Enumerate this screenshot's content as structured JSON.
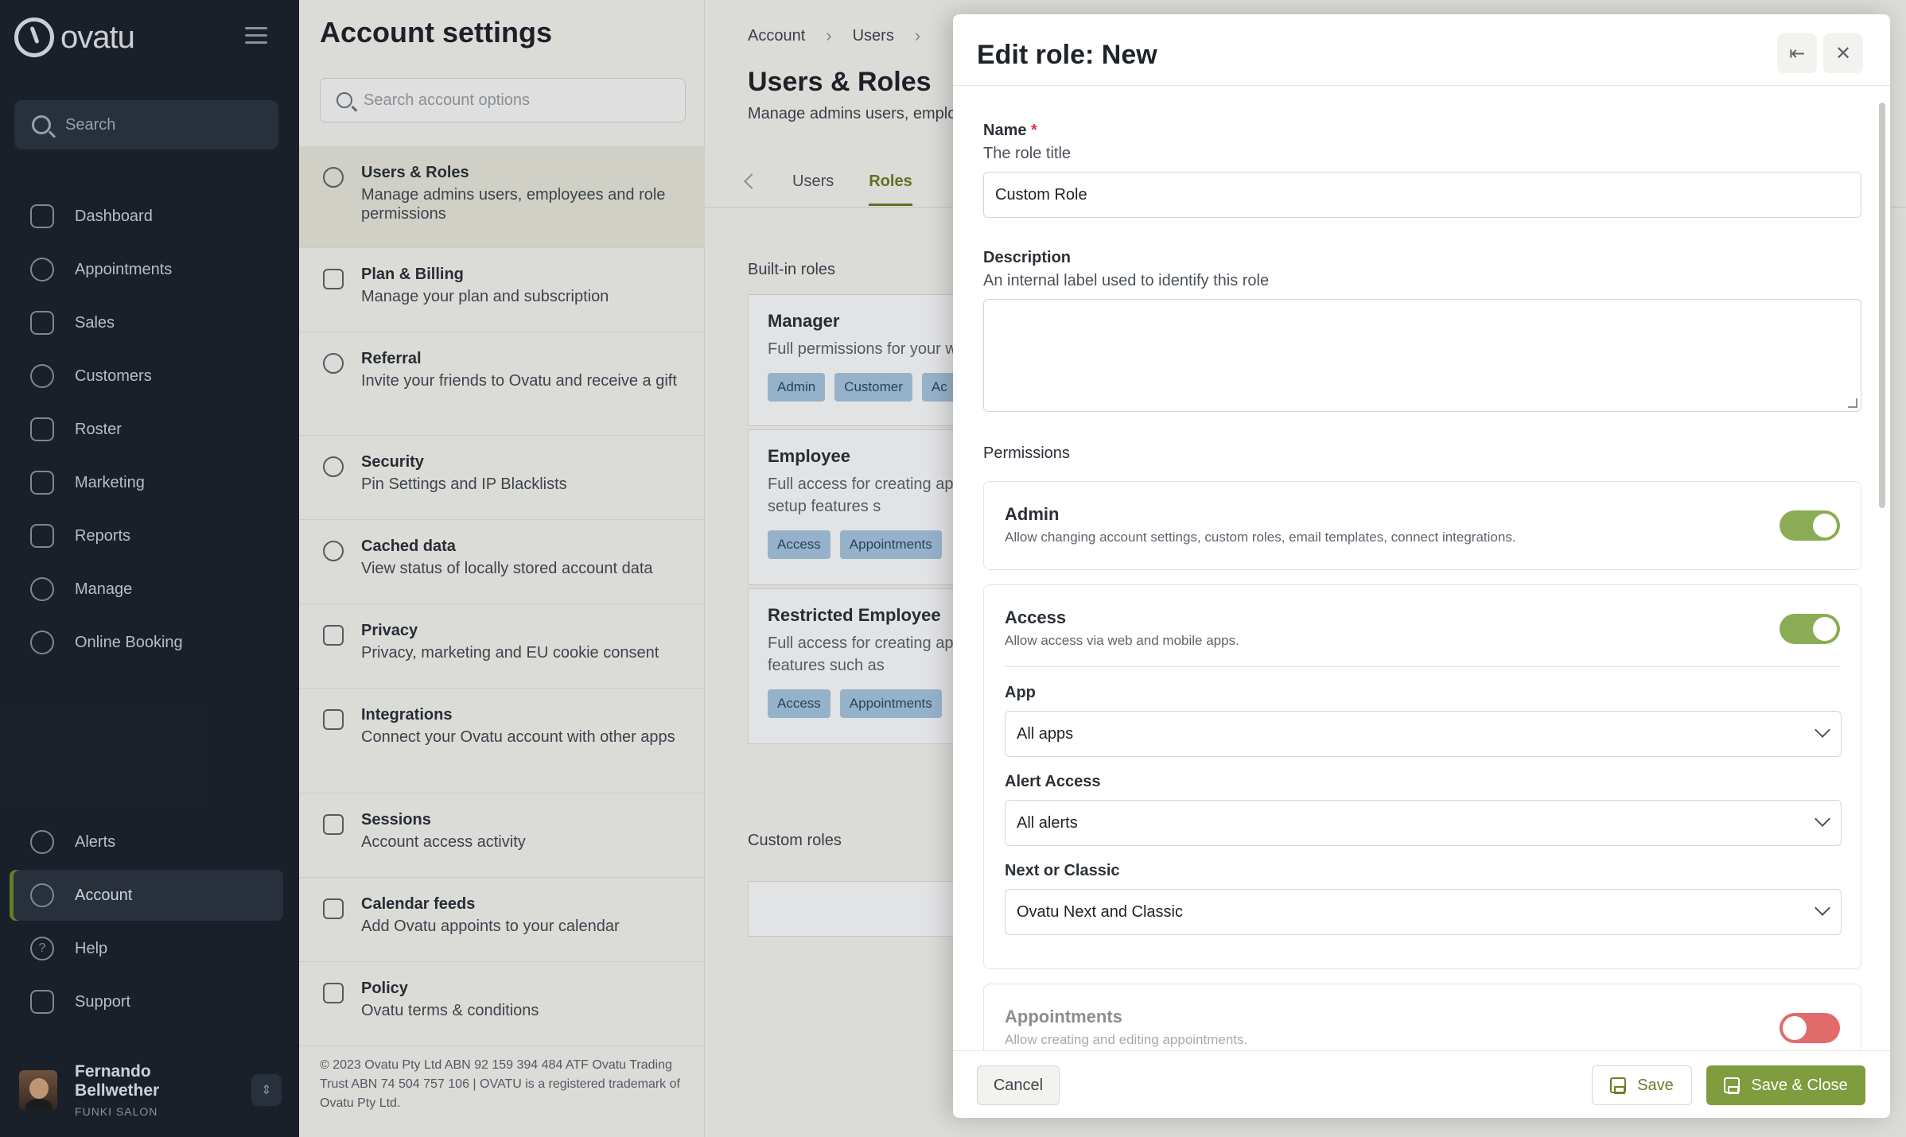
{
  "brand": {
    "name": "ovatu"
  },
  "nav": {
    "search_label": "Search",
    "items": [
      {
        "label": "Dashboard",
        "icon": "home-icon"
      },
      {
        "label": "Appointments",
        "icon": "clock-icon"
      },
      {
        "label": "Sales",
        "icon": "tag-icon"
      },
      {
        "label": "Customers",
        "icon": "users-icon"
      },
      {
        "label": "Roster",
        "icon": "calendar-grid-icon"
      },
      {
        "label": "Marketing",
        "icon": "megaphone-icon"
      },
      {
        "label": "Reports",
        "icon": "bar-chart-icon"
      },
      {
        "label": "Manage",
        "icon": "gears-icon"
      },
      {
        "label": "Online Booking",
        "icon": "globe-icon"
      }
    ],
    "bottom_items": [
      {
        "label": "Alerts",
        "icon": "bell-icon"
      },
      {
        "label": "Account",
        "icon": "account-circle-icon",
        "active": true
      },
      {
        "label": "Help",
        "icon": "help-circle-icon"
      },
      {
        "label": "Support",
        "icon": "chat-bubble-icon"
      }
    ],
    "user": {
      "name": "Fernando Bellwether",
      "org": "FUNKI SALON"
    }
  },
  "settings": {
    "title": "Account settings",
    "search_placeholder": "Search account options",
    "items": [
      {
        "title": "Users & Roles",
        "desc": "Manage admins users, employees and role permissions",
        "icon": "person-icon",
        "active": true
      },
      {
        "title": "Plan & Billing",
        "desc": "Manage your plan and subscription",
        "icon": "billing-icon"
      },
      {
        "title": "Referral",
        "desc": "Invite your friends to Ovatu and receive a gift",
        "icon": "info-icon"
      },
      {
        "title": "Security",
        "desc": "Pin Settings and IP Blacklists",
        "icon": "security-gear-icon"
      },
      {
        "title": "Cached data",
        "desc": "View status of locally stored account data",
        "icon": "database-icon"
      },
      {
        "title": "Privacy",
        "desc": "Privacy, marketing and EU cookie consent",
        "icon": "privacy-icon"
      },
      {
        "title": "Integrations",
        "desc": "Connect your Ovatu account with other apps",
        "icon": "box-icon"
      },
      {
        "title": "Sessions",
        "desc": "Account access activity",
        "icon": "sessions-icon"
      },
      {
        "title": "Calendar feeds",
        "desc": "Add Ovatu appoints to your calendar",
        "icon": "calendar-icon"
      },
      {
        "title": "Policy",
        "desc": "Ovatu terms & conditions",
        "icon": "policy-icon"
      }
    ],
    "copyright": "© 2023 Ovatu Pty Ltd ABN 92 159 394 484 ATF Ovatu Trading Trust ABN 74 504 757 106 | OVATU is a registered trademark of Ovatu Pty Ltd."
  },
  "main": {
    "breadcrumb": [
      "Account",
      "Users"
    ],
    "title": "Users & Roles",
    "subtitle": "Manage admins users, emplo",
    "tabs": [
      "Users",
      "Roles"
    ],
    "active_tab": "Roles",
    "builtin_label": "Built-in roles",
    "custom_label": "Custom roles",
    "roles": [
      {
        "name": "Manager",
        "desc": "Full permissions for your w",
        "chips": [
          "Admin",
          "Customer",
          "Ac"
        ]
      },
      {
        "name": "Employee",
        "desc": "Full access for creating ap access to setup features s",
        "chips": [
          "Access",
          "Appointments"
        ]
      },
      {
        "name": "Restricted Employee",
        "desc": "Full access for creating ap to setup features such as",
        "chips": [
          "Access",
          "Appointments"
        ]
      }
    ]
  },
  "modal": {
    "title": "Edit role: New",
    "name_label": "Name",
    "name_required": "*",
    "name_help": "The role title",
    "name_value": "Custom Role",
    "desc_label": "Description",
    "desc_help": "An internal label used to identify this role",
    "desc_value": "",
    "permissions_label": "Permissions",
    "permissions": {
      "admin": {
        "title": "Admin",
        "desc": "Allow changing account settings, custom roles, email templates, connect integrations.",
        "enabled": true
      },
      "access": {
        "title": "Access",
        "desc": "Allow access via web and mobile apps.",
        "enabled": true,
        "app_label": "App",
        "app_value": "All apps",
        "alert_label": "Alert Access",
        "alert_value": "All alerts",
        "next_label": "Next or Classic",
        "next_value": "Ovatu Next and Classic"
      },
      "appointments": {
        "title": "Appointments",
        "desc": "Allow creating and editing appointments.",
        "enabled": false
      }
    },
    "cancel_label": "Cancel",
    "save_label": "Save",
    "save_close_label": "Save & Close"
  },
  "colors": {
    "accent": "#7f9c3e",
    "toggle_on": "#8aac54",
    "toggle_off": "#e16b6b",
    "nav_bg": "#1b222c"
  }
}
